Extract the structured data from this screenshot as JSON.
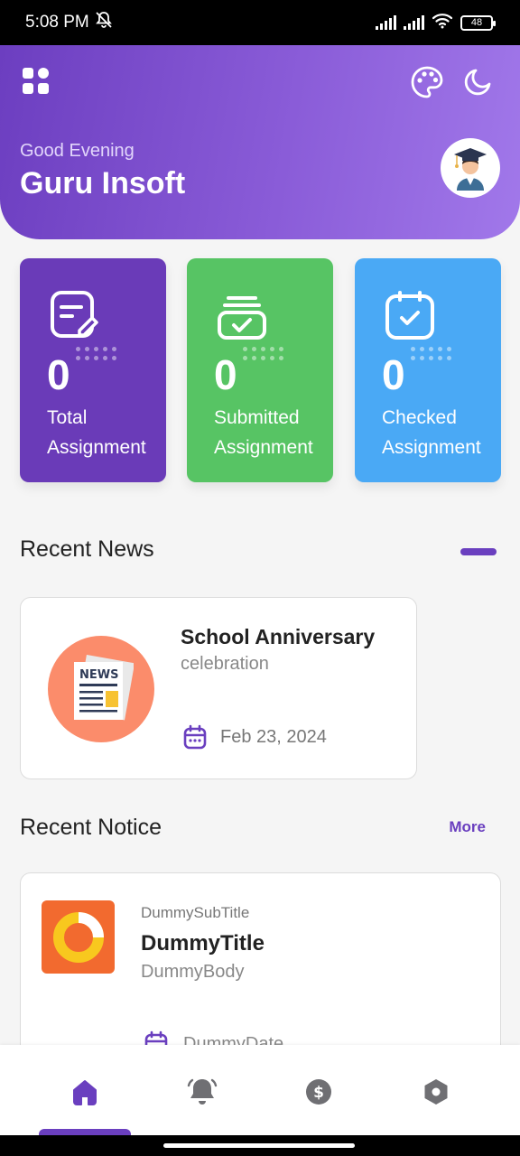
{
  "status_bar": {
    "time": "5:08 PM",
    "battery": "48"
  },
  "header": {
    "greeting": "Good Evening",
    "user_name": "Guru Insoft"
  },
  "stats": [
    {
      "value": "0",
      "label": "Total Assignment",
      "color": "#6a3bb8"
    },
    {
      "value": "0",
      "label": "Submitted Assignment",
      "color": "#57c464"
    },
    {
      "value": "0",
      "label": "Checked Assignment",
      "color": "#4aa9f5"
    }
  ],
  "recent_news": {
    "title": "Recent News",
    "item": {
      "title": "School Anniversary",
      "subtitle": "celebration",
      "date": "Feb 23, 2024",
      "image_text": "NEWS"
    }
  },
  "recent_notice": {
    "title": "Recent Notice",
    "more_label": "More",
    "item": {
      "subtitle": "DummySubTitle",
      "title": "DummyTitle",
      "body": "DummyBody",
      "date": "DummyDate"
    }
  },
  "bottom_nav": [
    {
      "icon": "home-icon",
      "active": true
    },
    {
      "icon": "bell-icon",
      "active": false
    },
    {
      "icon": "dollar-icon",
      "active": false
    },
    {
      "icon": "hexagon-icon",
      "active": false
    }
  ],
  "colors": {
    "accent": "#6a3fbf",
    "header_start": "#6c3ec0",
    "header_end": "#a178ea"
  }
}
